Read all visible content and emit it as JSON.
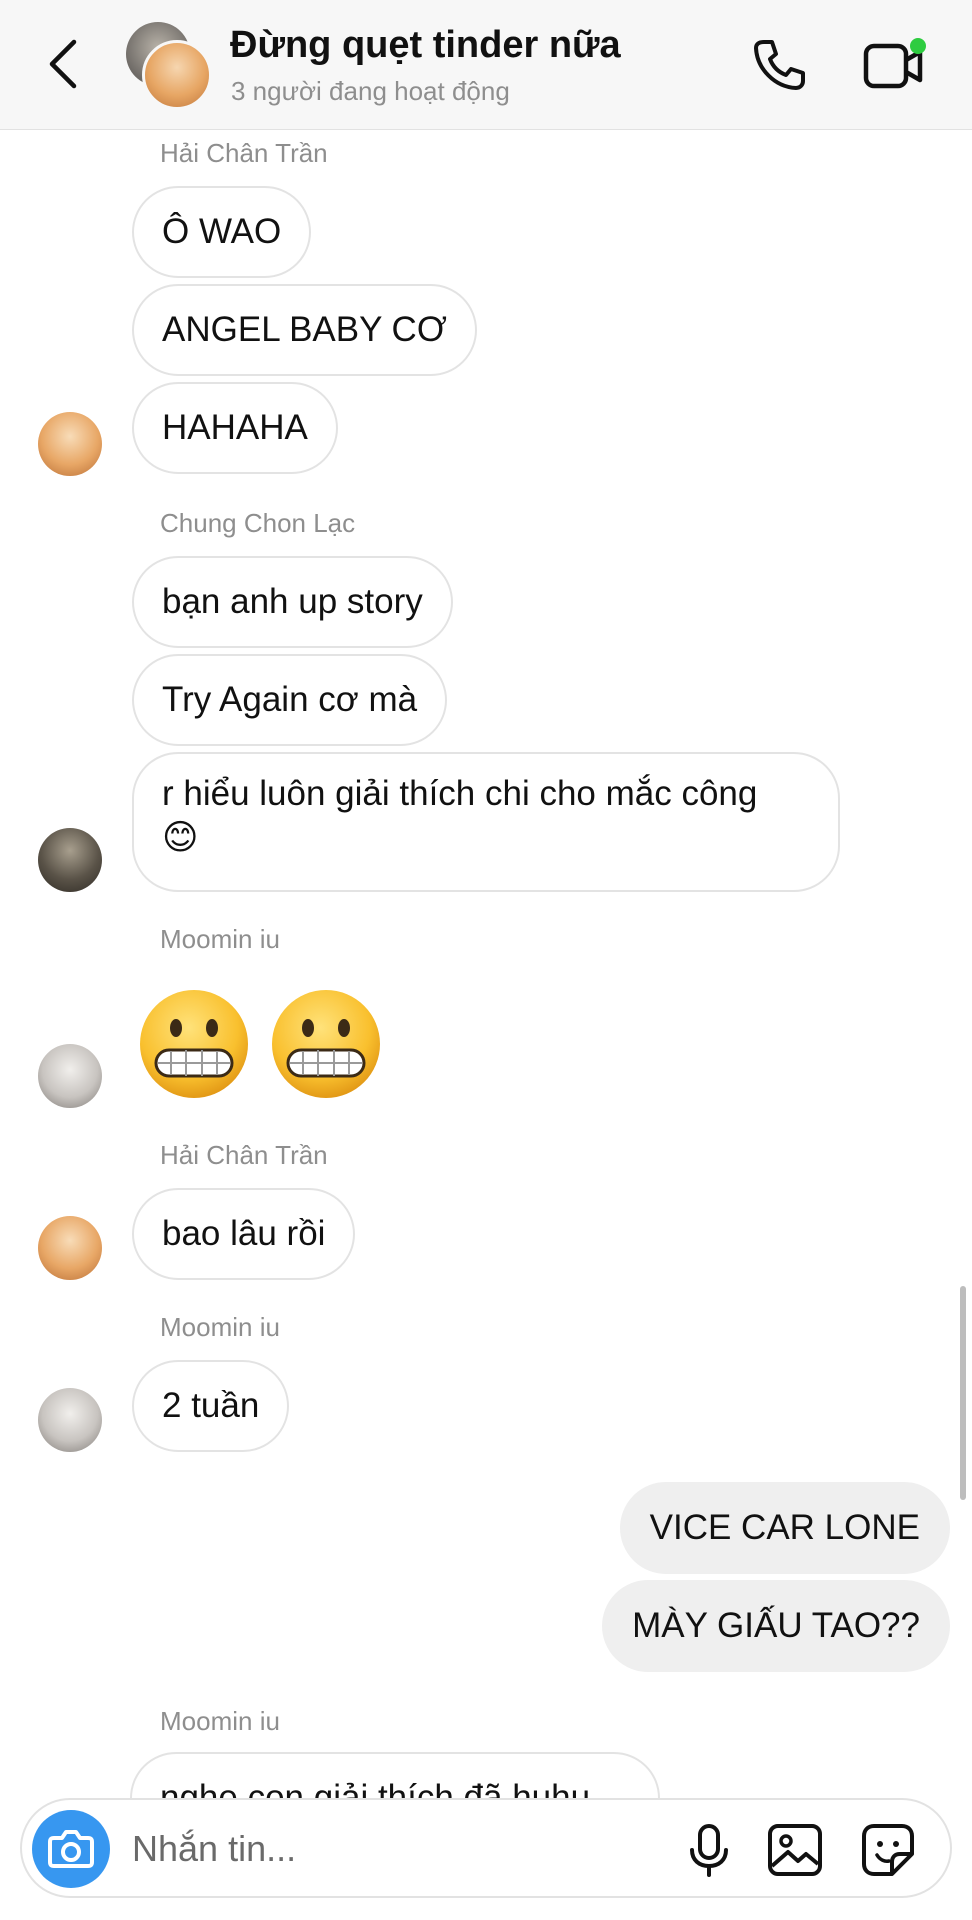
{
  "header": {
    "title": "Đừng quẹt tinder nữa",
    "subtitle": "3 người đang hoạt động"
  },
  "messages": {
    "hai_name_1": "Hải Chân Trần",
    "hai_msg_1": "Ô WAO",
    "hai_msg_2": "ANGEL BABY CƠ",
    "hai_msg_3": "HAHAHA",
    "chung_name": "Chung Chon Lạc",
    "chung_msg_1": "bạn anh up story",
    "chung_msg_2": "Try Again cơ mà",
    "chung_msg_3": "r hiểu luôn giải thích chi cho mắc công",
    "chung_msg_3_emoji": "😊",
    "moomin_name_1": "Moomin iu",
    "hai_name_2": "Hải Chân Trần",
    "hai_msg_4": "bao lâu rồi",
    "moomin_name_2": "Moomin iu",
    "moomin_msg_1": "2 tuần",
    "mine_msg_1": "VICE CAR LONE",
    "mine_msg_2": "MÀY GIẤU TAO??",
    "moomin_name_3": "Moomin iu",
    "moomin_msg_2": "nghe con giải thích đã huhu"
  },
  "composer": {
    "placeholder": "Nhắn tin..."
  },
  "icons": {
    "back": "chevron-left-icon",
    "call": "phone-icon",
    "video": "video-camera-icon",
    "camera": "camera-icon",
    "mic": "microphone-icon",
    "gallery": "image-icon",
    "sticker": "sticker-icon",
    "emoji": "grimacing-face-emoji"
  },
  "colors": {
    "accent": "#3797f0",
    "online": "#2ecc40",
    "bubble_border": "#e3e3e3",
    "own_bubble": "#efefef",
    "secondary_text": "#8e8e8e"
  }
}
